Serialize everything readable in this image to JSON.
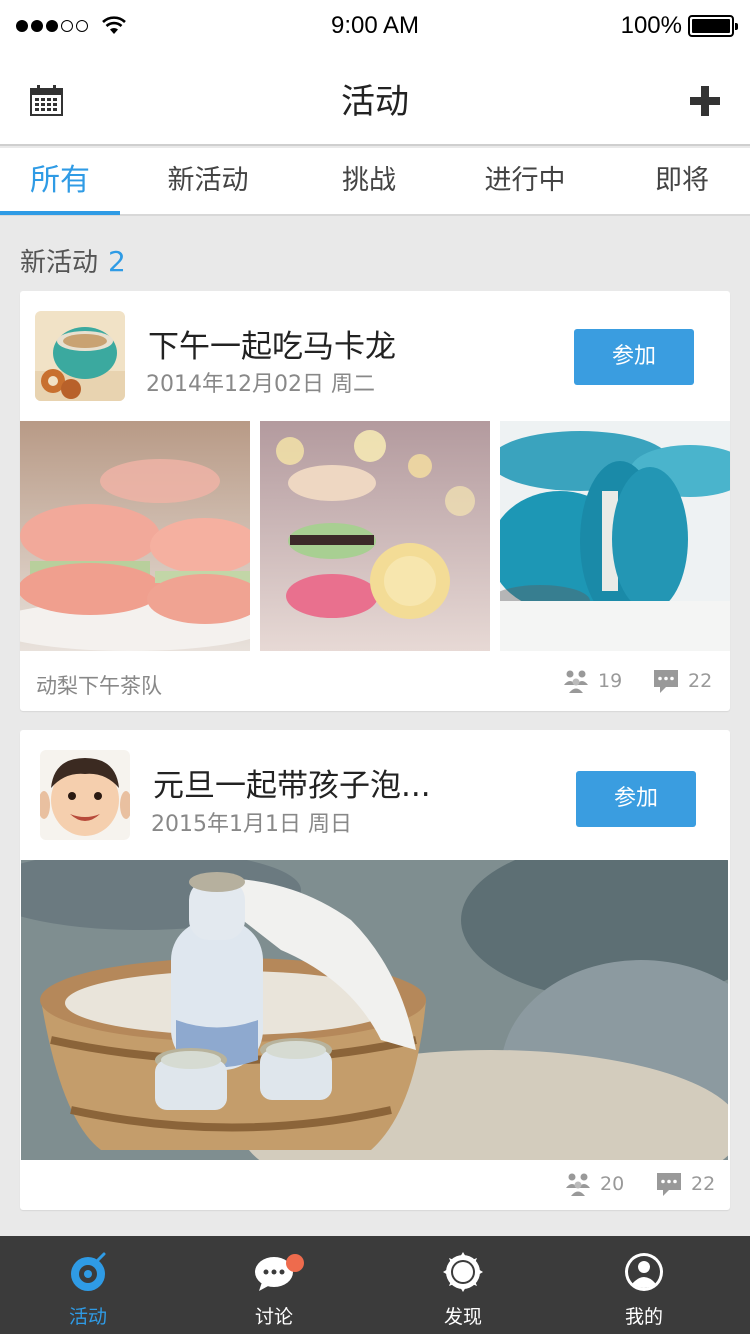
{
  "status_bar": {
    "time": "9:00 AM",
    "battery": "100%",
    "signal_bars_filled": 3,
    "signal_bars_total": 5
  },
  "header": {
    "title": "活动",
    "left_icon": "calendar-icon",
    "right_icon": "add-icon"
  },
  "tabs": [
    {
      "label": "所有",
      "active": true
    },
    {
      "label": "新活动",
      "active": false
    },
    {
      "label": "挑战",
      "active": false
    },
    {
      "label": "进行中",
      "active": false
    },
    {
      "label": "即将",
      "active": false
    }
  ],
  "section": {
    "title": "新活动",
    "count": "2"
  },
  "activities": [
    {
      "title": "下午一起吃马卡龙",
      "date": "2014年12月02日  周二",
      "join_label": "参加",
      "team": "动梨下午茶队",
      "members": "19",
      "comments": "22"
    },
    {
      "title": "元旦一起带孩子泡...",
      "date": "2015年1月1日  周日",
      "join_label": "参加",
      "team": "",
      "members": "20",
      "comments": "22"
    }
  ],
  "bottom_nav": [
    {
      "label": "活动",
      "icon": "activity-icon",
      "active": true
    },
    {
      "label": "讨论",
      "icon": "chat-icon",
      "active": false,
      "badge": true
    },
    {
      "label": "发现",
      "icon": "discover-icon",
      "active": false
    },
    {
      "label": "我的",
      "icon": "profile-icon",
      "active": false
    }
  ],
  "colors": {
    "accent": "#2f9be5",
    "button": "#3a9de0",
    "nav_bg": "#3b3b3b",
    "badge": "#ee6b4d"
  }
}
